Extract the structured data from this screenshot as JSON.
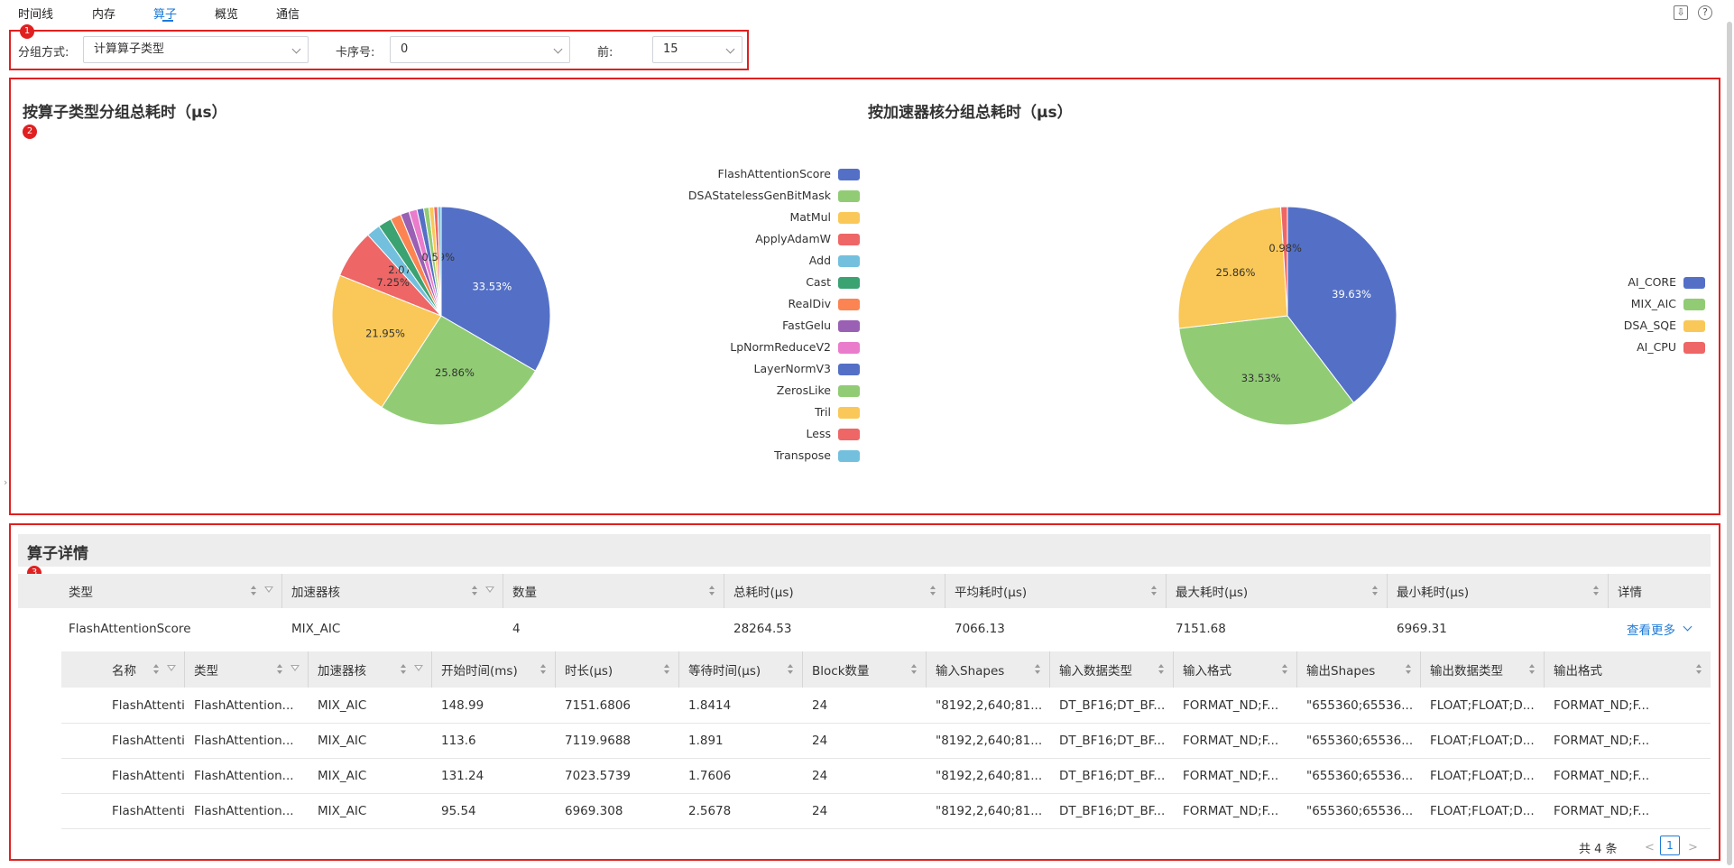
{
  "nav": {
    "tabs": [
      {
        "label": "时间线"
      },
      {
        "label": "内存"
      },
      {
        "label": "算子"
      },
      {
        "label": "概览"
      },
      {
        "label": "通信"
      }
    ],
    "active_tab": "算子",
    "export_icon": "export-icon",
    "help_icon": "help-icon"
  },
  "annotations": [
    "1",
    "2",
    "3"
  ],
  "filters": {
    "group_label": "分组方式:",
    "group_value": "计算算子类型",
    "card_label": "卡序号:",
    "card_value": "0",
    "top_label": "前:",
    "top_value": "15"
  },
  "chart_data": [
    {
      "type": "pie",
      "title": "按算子类型分组总耗时（μs）",
      "legend_placement": "right",
      "categories": [
        "FlashAttentionScore",
        "DSAStatelessGenBitMask",
        "MatMul",
        "ApplyAdamW",
        "Add",
        "Cast",
        "RealDiv",
        "FastGelu",
        "LpNormReduceV2",
        "LayerNormV3",
        "ZerosLike",
        "Tril",
        "Less",
        "Transpose"
      ],
      "values": [
        33.53,
        25.86,
        21.95,
        7.25,
        2.07,
        2.0,
        1.6,
        1.3,
        1.2,
        1.0,
        0.8,
        0.7,
        0.59,
        0.5
      ],
      "data_labels": [
        "33.53%",
        "25.86%",
        "21.95%",
        "7.25%",
        "2.07%",
        "",
        "",
        "",
        "",
        "",
        "",
        "",
        "0.59%",
        ""
      ],
      "colors": [
        "#5470c6",
        "#91cc75",
        "#fac858",
        "#ee6666",
        "#73c0de",
        "#3ba272",
        "#fc8452",
        "#9a60b4",
        "#ea7ccc",
        "#5470c6",
        "#91cc75",
        "#fac858",
        "#ee6666",
        "#73c0de"
      ]
    },
    {
      "type": "pie",
      "title": "按加速器核分组总耗时（μs）",
      "legend_placement": "right",
      "categories": [
        "AI_CORE",
        "MIX_AIC",
        "DSA_SQE",
        "AI_CPU"
      ],
      "values": [
        39.63,
        33.53,
        25.86,
        0.98
      ],
      "data_labels": [
        "39.63%",
        "33.53%",
        "25.86%",
        "0.98%"
      ],
      "colors": [
        "#5470c6",
        "#91cc75",
        "#fac858",
        "#ee6666"
      ]
    }
  ],
  "details": {
    "title": "算子详情",
    "columns": [
      "类型",
      "加速器核",
      "数量",
      "总耗时(μs)",
      "平均耗时(μs)",
      "最大耗时(μs)",
      "最小耗时(μs)",
      "详情"
    ],
    "row": {
      "type": "FlashAttentionScore",
      "core": "MIX_AIC",
      "count": "4",
      "total": "28264.53",
      "avg": "7066.13",
      "max": "7151.68",
      "min": "6969.31",
      "more": "查看更多"
    },
    "sub_columns": [
      "名称",
      "类型",
      "加速器核",
      "开始时间(ms)",
      "时长(μs)",
      "等待时间(μs)",
      "Block数量",
      "输入Shapes",
      "输入数据类型",
      "输入格式",
      "输出Shapes",
      "输出数据类型",
      "输出格式"
    ],
    "sub_rows": [
      [
        "FlashAttention...",
        "FlashAttention...",
        "MIX_AIC",
        "148.99",
        "7151.6806",
        "1.8414",
        "24",
        "\"8192,2,640;81...",
        "DT_BF16;DT_BF...",
        "FORMAT_ND;F...",
        "\"655360;65536...",
        "FLOAT;FLOAT;D...",
        "FORMAT_ND;F..."
      ],
      [
        "FlashAttention...",
        "FlashAttention...",
        "MIX_AIC",
        "113.6",
        "7119.9688",
        "1.891",
        "24",
        "\"8192,2,640;81...",
        "DT_BF16;DT_BF...",
        "FORMAT_ND;F...",
        "\"655360;65536...",
        "FLOAT;FLOAT;D...",
        "FORMAT_ND;F..."
      ],
      [
        "FlashAttention...",
        "FlashAttention...",
        "MIX_AIC",
        "131.24",
        "7023.5739",
        "1.7606",
        "24",
        "\"8192,2,640;81...",
        "DT_BF16;DT_BF...",
        "FORMAT_ND;F...",
        "\"655360;65536...",
        "FLOAT;FLOAT;D...",
        "FORMAT_ND;F..."
      ],
      [
        "FlashAttention...",
        "FlashAttention...",
        "MIX_AIC",
        "95.54",
        "6969.308",
        "2.5678",
        "24",
        "\"8192,2,640;81...",
        "DT_BF16;DT_BF...",
        "FORMAT_ND;F...",
        "\"655360;65536...",
        "FLOAT;FLOAT;D...",
        "FORMAT_ND;F..."
      ]
    ]
  },
  "pagination": {
    "total": "共 4 条",
    "current": "1",
    "prev": "<",
    "next": ">"
  }
}
